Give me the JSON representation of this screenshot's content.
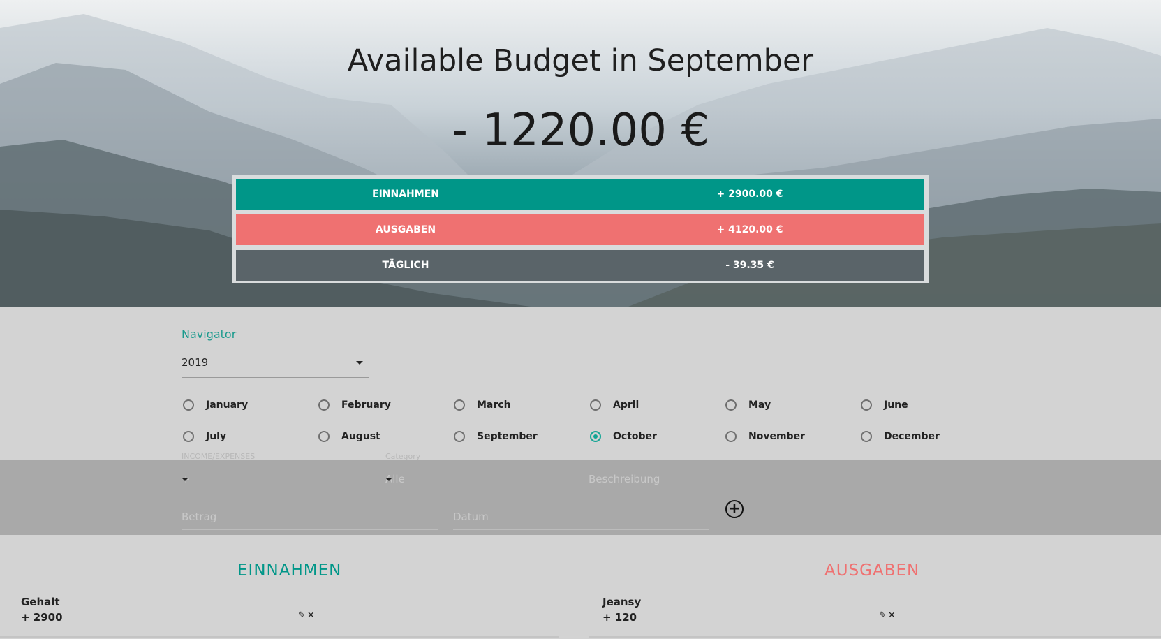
{
  "hero": {
    "title": "Available Budget in September",
    "amount": "- 1220.00 €"
  },
  "summary": {
    "income_label": "EINNAHMEN",
    "income_value": "+ 2900.00 €",
    "expenses_label": "AUSGABEN",
    "expenses_value": "+ 4120.00 €",
    "daily_label": "TÄGLICH",
    "daily_value": "- 39.35 €"
  },
  "navigator": {
    "label": "Navigator",
    "year": "2019",
    "months": [
      "January",
      "February",
      "March",
      "April",
      "May",
      "June",
      "July",
      "August",
      "September",
      "October",
      "November",
      "December"
    ],
    "selected_month": "October"
  },
  "form": {
    "type_label": "INCOME/EXPENSES",
    "type_value": "+",
    "category_label": "Category",
    "category_value": "Alle",
    "description_placeholder": "Beschreibung",
    "amount_placeholder": "Betrag",
    "date_placeholder": "Datum",
    "add_icon": "plus-circle-icon"
  },
  "lists": {
    "income_title": "EINNAHMEN",
    "expenses_title": "AUSGABEN",
    "income_items": [
      {
        "description": "Gehalt",
        "value": "+ 2900"
      }
    ],
    "expense_items": [
      {
        "description": "Jeansy",
        "value": "+ 120"
      }
    ]
  },
  "colors": {
    "income": "#009688",
    "expenses": "#ef7171",
    "daily": "#5a6469",
    "accent": "#12a594"
  }
}
